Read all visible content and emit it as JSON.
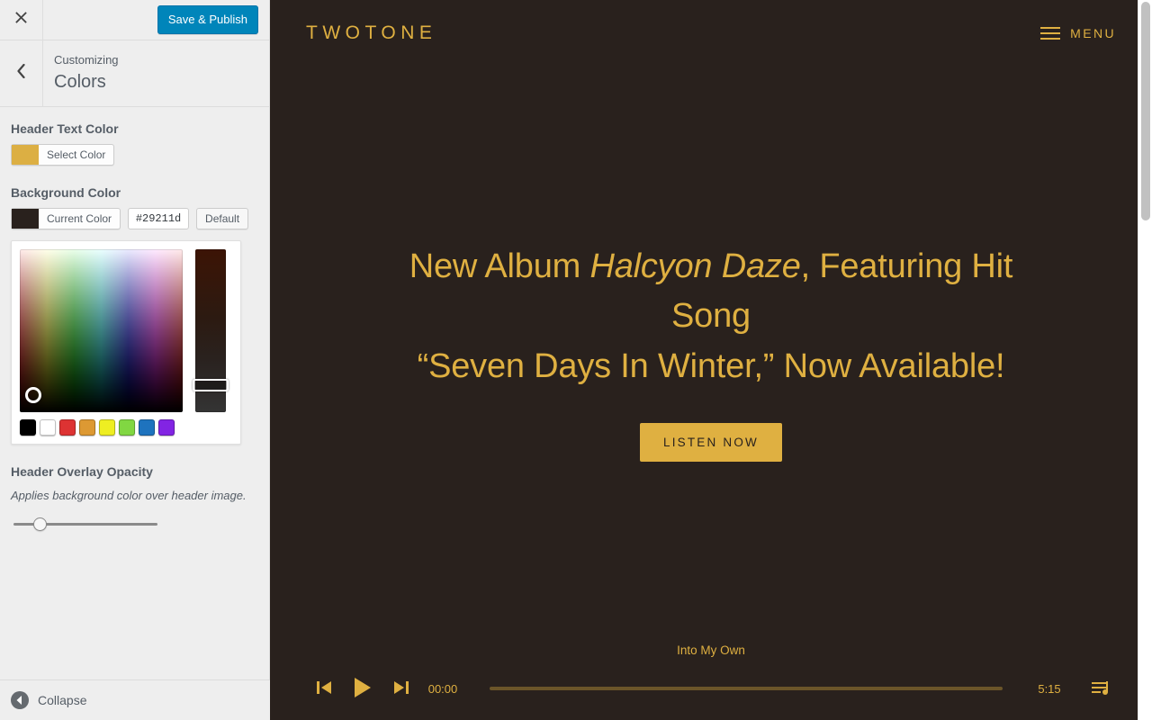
{
  "customizer": {
    "close_icon": "close-icon",
    "save_label": "Save & Publish",
    "back_icon": "chevron-left-icon",
    "eyebrow": "Customizing",
    "panel_title": "Colors",
    "header_text_color": {
      "label": "Header Text Color",
      "button_label": "Select Color",
      "swatch_hex": "#dcaf43"
    },
    "background_color": {
      "label": "Background Color",
      "button_label": "Current Color",
      "swatch_hex": "#29211d",
      "hex_value": "#29211d",
      "default_label": "Default",
      "picker": {
        "palette": [
          {
            "name": "black",
            "hex": "#000000"
          },
          {
            "name": "white",
            "hex": "#ffffff"
          },
          {
            "name": "red",
            "hex": "#dd3333"
          },
          {
            "name": "orange",
            "hex": "#dd9933"
          },
          {
            "name": "yellow",
            "hex": "#eeee22"
          },
          {
            "name": "green",
            "hex": "#81d742"
          },
          {
            "name": "blue",
            "hex": "#1e73be"
          },
          {
            "name": "purple",
            "hex": "#8224e3"
          }
        ]
      }
    },
    "header_overlay_opacity": {
      "label": "Header Overlay Opacity",
      "description": "Applies background color over header image."
    },
    "collapse_label": "Collapse",
    "collapse_icon": "collapse-left-arrow-icon"
  },
  "preview": {
    "site_title": "TWOTONE",
    "menu_label": "MENU",
    "menu_icon": "hamburger-icon",
    "hero": {
      "line1_prefix": "New Album ",
      "line1_em": "Halcyon Daze",
      "line1_suffix": ", Featuring Hit Song",
      "line2": "“Seven Days In Winter,” Now Available!",
      "button_label": "LISTEN NOW"
    },
    "player": {
      "track_title": "Into My Own",
      "prev_icon": "skip-previous-icon",
      "play_icon": "play-icon",
      "next_icon": "skip-next-icon",
      "current_time": "00:00",
      "duration": "5:15",
      "progress_percent": 0,
      "queue_icon": "playlist-queue-icon"
    },
    "colors": {
      "background": "#29211d",
      "accent_gold": "#dfb041",
      "progress_track": "#6b5529"
    }
  }
}
